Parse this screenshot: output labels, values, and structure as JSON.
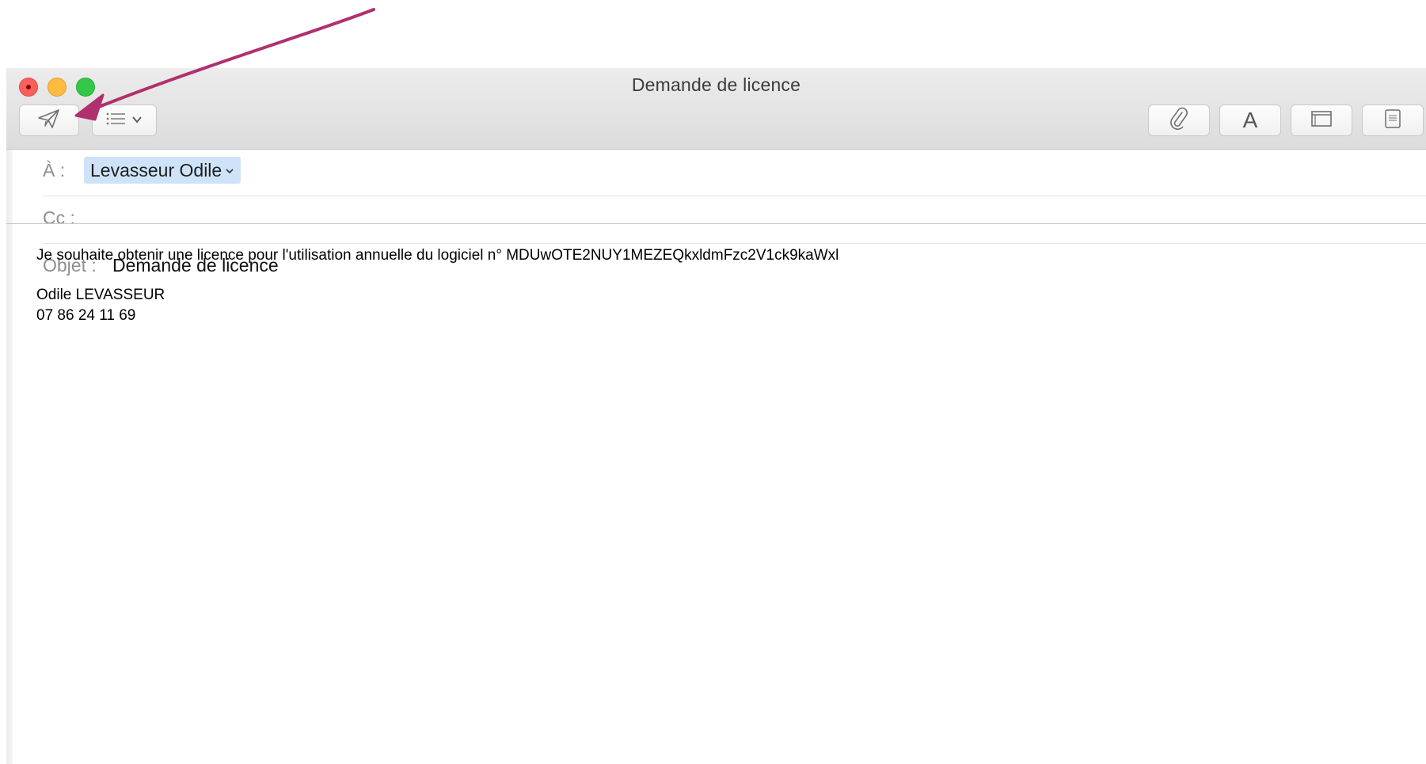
{
  "window": {
    "title": "Demande de licence"
  },
  "toolbar": {
    "send_icon": "paper-plane-icon",
    "header_fields_icon": "list-chevron-icon",
    "attach_icon": "paperclip-icon",
    "font_label": "A",
    "browser_icon": "window-icon",
    "photo_icon": "photo-browser-icon"
  },
  "header": {
    "to_label": "À :",
    "to_recipient": "Levasseur Odile",
    "cc_label": "Cc :",
    "subject_label": "Objet :",
    "subject_value": "Demande de licence"
  },
  "message": {
    "line1": "Je souhaite obtenir une licence pour l'utilisation annuelle du logiciel n° MDUwOTE2NUY1MEZEQkxldmFzc2V1ck9kaWxl",
    "signature_name": "Odile LEVASSEUR",
    "signature_phone": "07 86 24 11 69"
  },
  "colors": {
    "annotation_arrow": "#b0306e",
    "recipient_highlight": "#cfe3f8",
    "close": "#fc605b",
    "minimize": "#fdbc40",
    "zoom": "#34c84a"
  }
}
